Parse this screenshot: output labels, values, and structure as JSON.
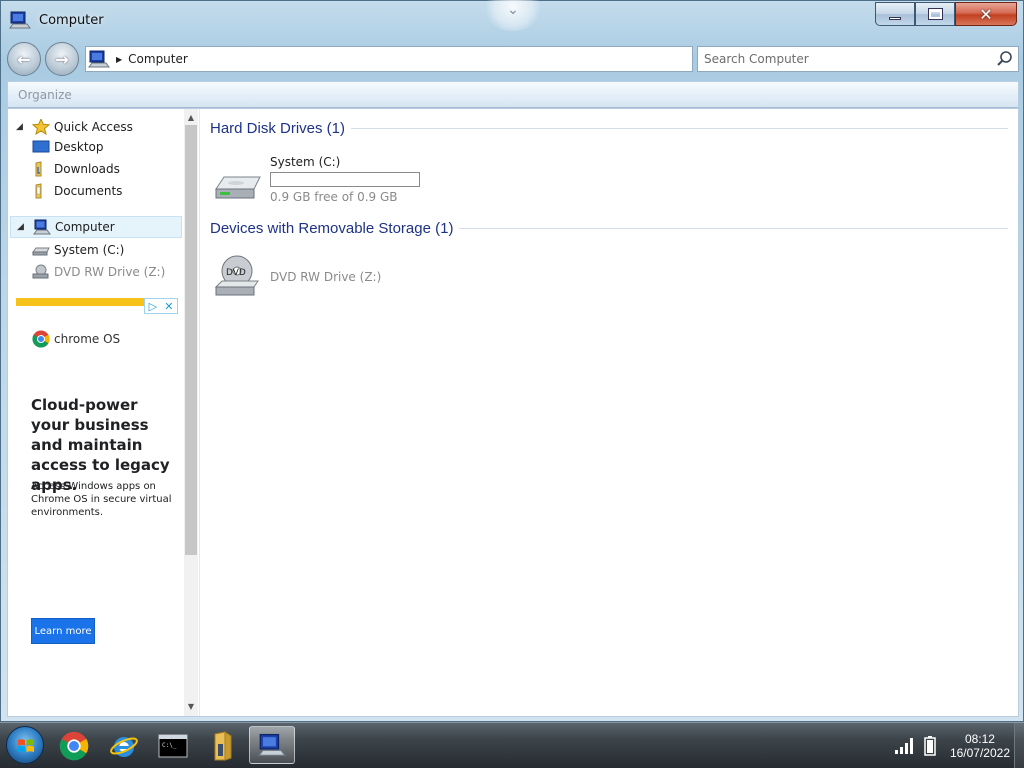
{
  "window": {
    "title": "Computer",
    "controls": {
      "minimize": "minimize",
      "maximize": "maximize",
      "close": "✕"
    }
  },
  "address": {
    "path": "Computer",
    "search_placeholder": "Search Computer"
  },
  "toolbar": {
    "organize_label": "Organize"
  },
  "nav": {
    "quick_access": {
      "label": "Quick Access",
      "items": [
        {
          "label": "Desktop",
          "icon": "desktop-icon"
        },
        {
          "label": "Downloads",
          "icon": "downloads-folder-icon"
        },
        {
          "label": "Documents",
          "icon": "documents-folder-icon"
        }
      ]
    },
    "computer": {
      "label": "Computer",
      "items": [
        {
          "label": "System (C:)",
          "icon": "hard-drive-icon"
        },
        {
          "label": "DVD RW Drive (Z:)",
          "icon": "dvd-drive-icon"
        }
      ]
    }
  },
  "ad": {
    "brand": "chrome OS",
    "headline": "Cloud-power your business and maintain access to legacy apps.",
    "body": "Access Windows apps on Chrome OS in secure virtual environments.",
    "cta": "Learn more",
    "colors": {
      "strip": "#f7c21a",
      "cta": "#1a73e8"
    }
  },
  "groups": {
    "hard_disks": {
      "title": "Hard Disk Drives (1)",
      "drives": [
        {
          "name": "System (C:)",
          "free_text": "0.9 GB free of 0.9 GB",
          "used_fraction": 0.0
        }
      ]
    },
    "removable": {
      "title": "Devices with Removable Storage (1)",
      "drives": [
        {
          "name": "DVD RW Drive (Z:)"
        }
      ]
    }
  },
  "taskbar": {
    "pinned": [
      "chrome-icon",
      "internet-explorer-icon",
      "command-prompt-icon",
      "file-explorer-icon",
      "computer-icon"
    ],
    "clock": {
      "time": "08:12",
      "date": "16/07/2022"
    }
  }
}
